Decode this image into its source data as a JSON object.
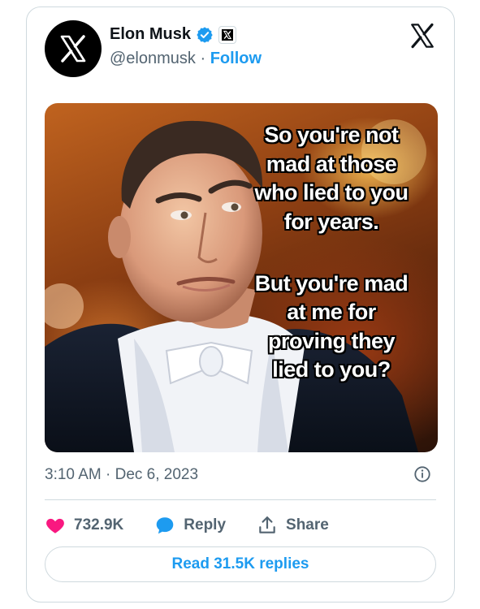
{
  "author": {
    "name": "Elon Musk",
    "handle": "@elonmusk",
    "separator": "·",
    "follow_label": "Follow"
  },
  "icons": {
    "avatar": "x-logo-icon",
    "verified": "verified-badge-icon",
    "affiliation": "x-affiliation-icon",
    "platform": "x-logo-icon",
    "info": "info-icon",
    "like": "heart-icon",
    "reply": "speech-bubble-icon",
    "share": "share-upload-icon"
  },
  "media": {
    "meme_lines_1": [
      "So you're not",
      "mad at those",
      "who lied to you",
      "for years."
    ],
    "meme_lines_2": [
      "But you're mad",
      "at me for",
      "proving they",
      "lied to you?"
    ]
  },
  "timestamp": "3:10 AM · Dec 6, 2023",
  "actions": {
    "likes": "732.9K",
    "reply_label": "Reply",
    "share_label": "Share"
  },
  "read_replies_label": "Read 31.5K replies",
  "colors": {
    "accent": "#1d9bf0",
    "heart": "#f91880",
    "text": "#0f1419",
    "muted": "#536471",
    "border": "#cfd9de"
  }
}
